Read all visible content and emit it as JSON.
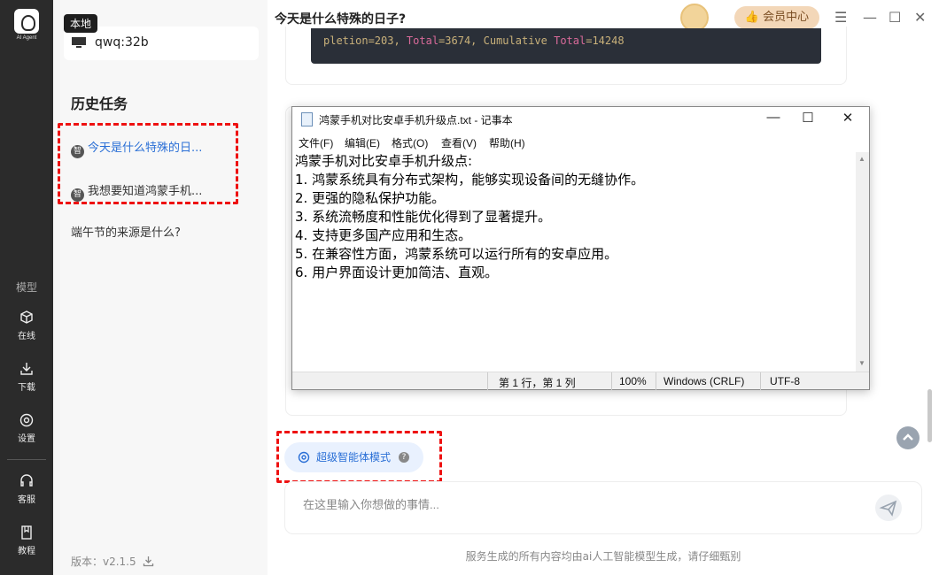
{
  "rail": {
    "logo_caption": "AI Agent",
    "section_label": "模型",
    "nav": [
      {
        "label": "在线",
        "icon": "cube-icon"
      },
      {
        "label": "下载",
        "icon": "download-icon"
      },
      {
        "label": "设置",
        "icon": "gear-icon"
      },
      {
        "label": "客服",
        "icon": "headset-icon"
      },
      {
        "label": "教程",
        "icon": "book-icon"
      }
    ]
  },
  "sidebar": {
    "local_tag": "本地",
    "model_name": "qwq:32b",
    "history_title": "历史任务",
    "history": [
      {
        "label": "今天是什么特殊的日...",
        "badge": "智"
      },
      {
        "label": "我想要知道鸿蒙手机...",
        "badge": "智"
      },
      {
        "label": "端午节的来源是什么?"
      }
    ],
    "version": "版本：v2.1.5"
  },
  "header": {
    "title": "今天是什么特殊的日子?",
    "vip_label": "会员中心"
  },
  "chat": {
    "code_line": {
      "prefix": "pletion=203, ",
      "kw1": "Total",
      "mid": "=3674, Cumulative ",
      "kw2": "Total",
      "suffix": "=14248"
    },
    "agent_mode_label": "超级智能体模式",
    "input_placeholder": "在这里输入你想做的事情...",
    "disclaimer": "服务生成的所有内容均由ai人工智能模型生成，请仔细甄别"
  },
  "notepad": {
    "title": "鸿蒙手机对比安卓手机升级点.txt - 记事本",
    "menu": [
      "文件(F)",
      "编辑(E)",
      "格式(O)",
      "查看(V)",
      "帮助(H)"
    ],
    "lines": [
      "鸿蒙手机对比安卓手机升级点:",
      "1. 鸿蒙系统具有分布式架构，能够实现设备间的无缝协作。",
      "2. 更强的隐私保护功能。",
      "3. 系统流畅度和性能优化得到了显著提升。",
      "4. 支持更多国产应用和生态。",
      "5. 在兼容性方面，鸿蒙系统可以运行所有的安卓应用。",
      "6. 用户界面设计更加简洁、直观。"
    ],
    "status": {
      "position": "第 1 行，第 1 列",
      "zoom": "100%",
      "line_ending": "Windows (CRLF)",
      "encoding": "UTF-8"
    }
  },
  "colors": {
    "accent": "#2a6fd6",
    "highlight_dash": "#e11111",
    "rail_bg": "#2b2b2b"
  }
}
